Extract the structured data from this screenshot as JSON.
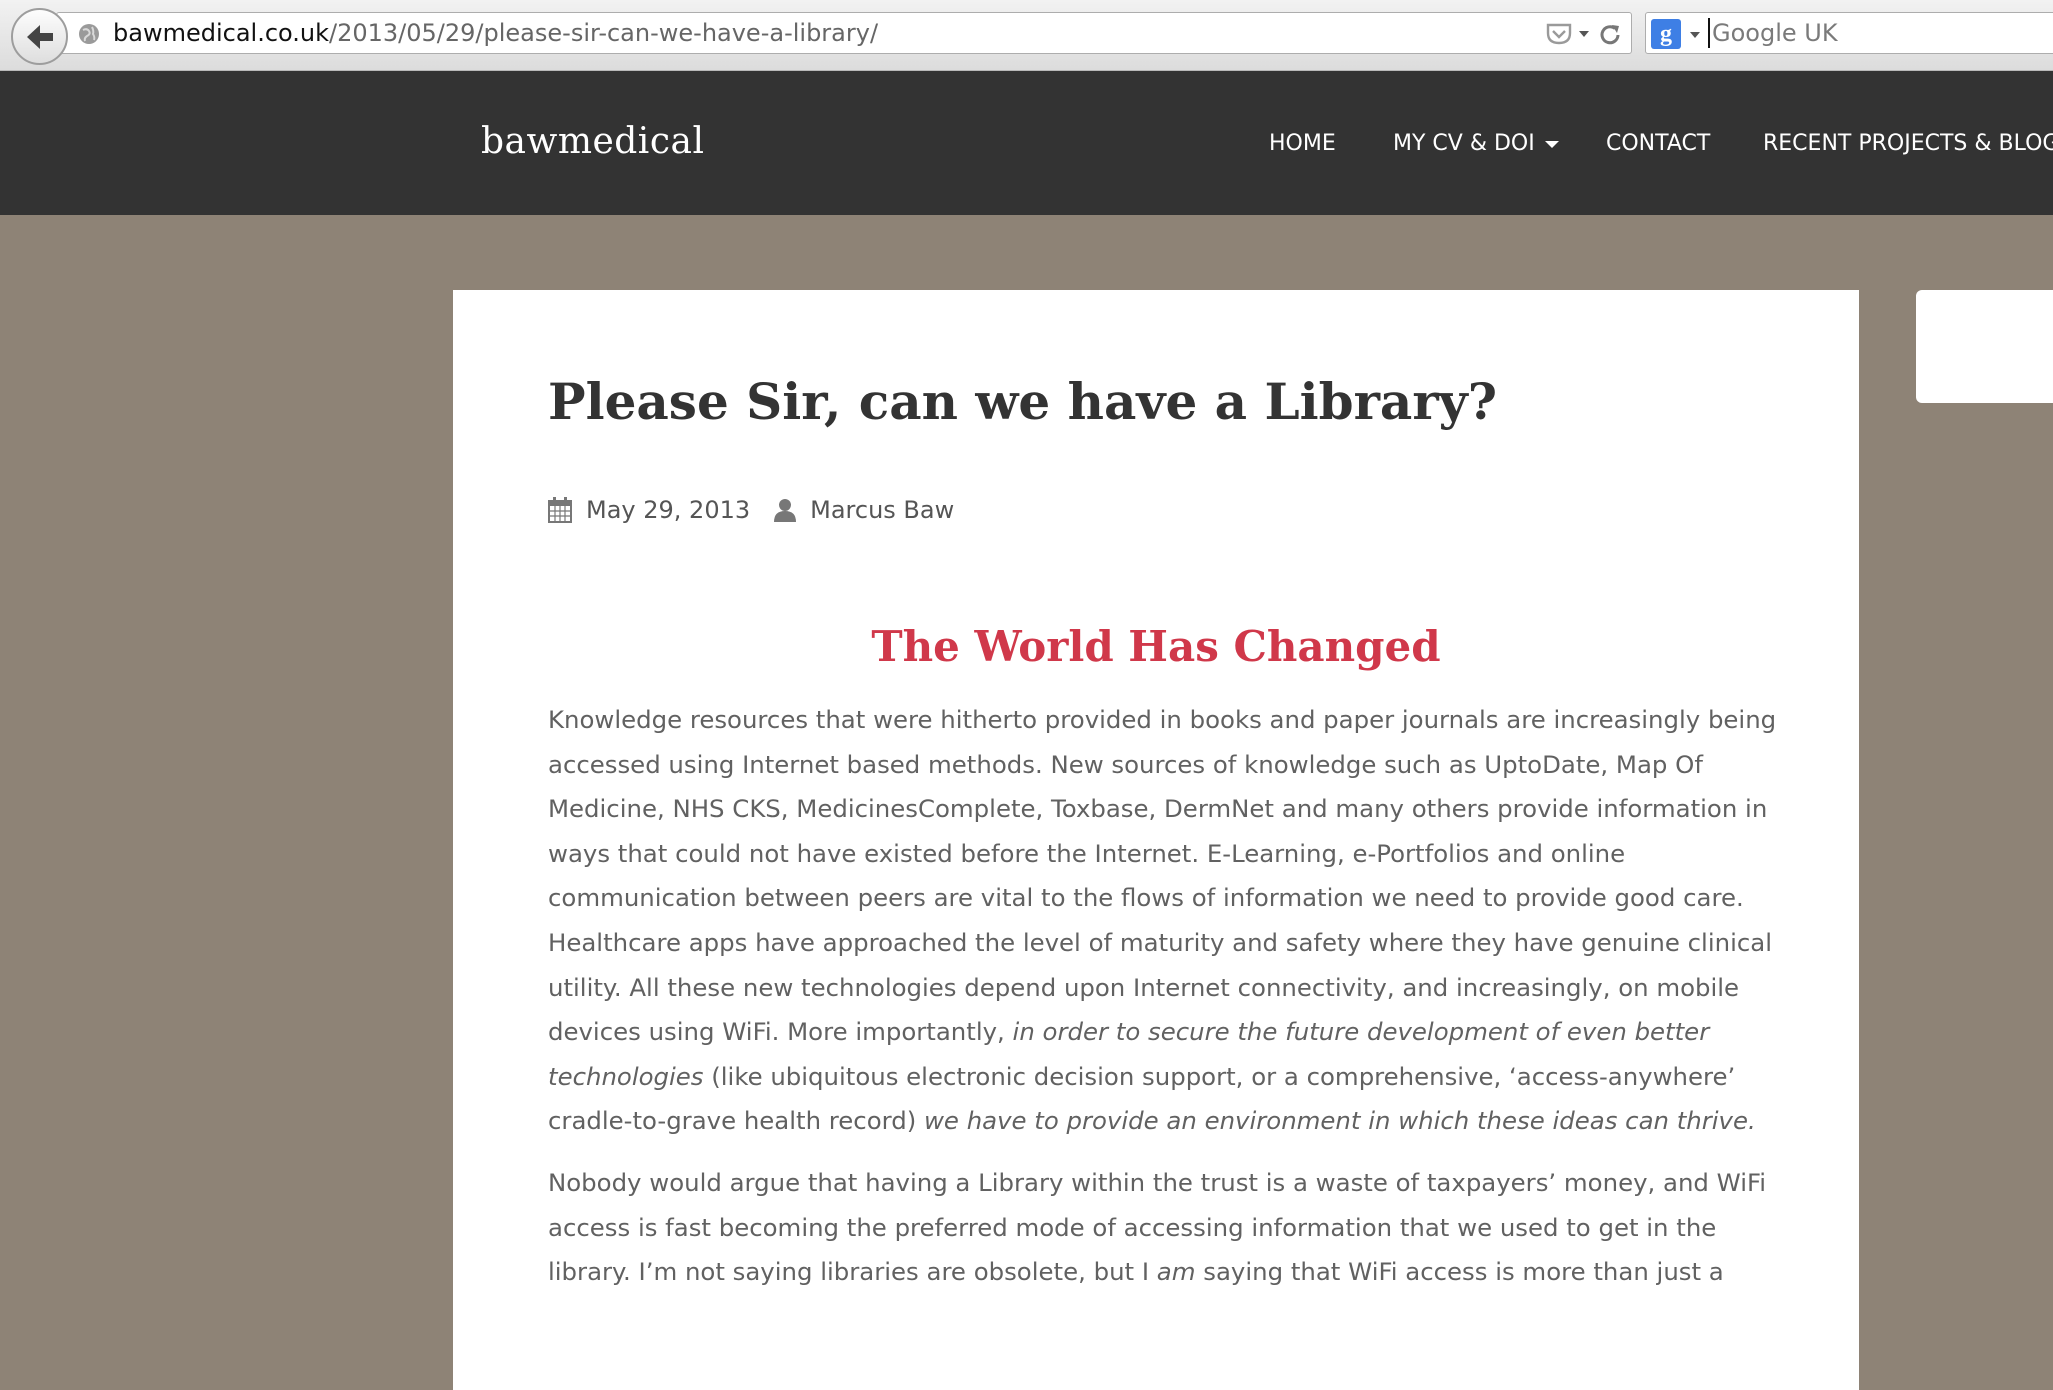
{
  "browser": {
    "url_domain": "bawmedical.co.uk",
    "url_path": "/2013/05/29/please-sir-can-we-have-a-library/",
    "search_engine_icon": "google-g-icon",
    "search_placeholder": "Google UK",
    "icons": [
      "back-arrow-icon",
      "globe-icon",
      "pocket-icon",
      "reload-icon",
      "google-g-icon"
    ]
  },
  "header": {
    "site_title": "bawmedical",
    "nav": [
      {
        "label": "HOME"
      },
      {
        "label": "MY CV & DOI",
        "has_dropdown": true
      },
      {
        "label": "CONTACT"
      },
      {
        "label": "RECENT PROJECTS & BLOG"
      }
    ]
  },
  "post": {
    "title": "Please Sir, can we have a Library?",
    "date": "May 29, 2013",
    "author": "Marcus Baw",
    "section_heading": "The World Has Changed",
    "p1": {
      "a": "Knowledge resources that were hitherto provided in books and paper journals are increasingly being accessed using Internet based methods. New sources of knowledge such as UptoDate, Map Of Medicine, NHS CKS, MedicinesComplete, Toxbase, DermNet and many others provide information in ways that could not have existed before the Internet.  E-Learning, e-Portfolios and online communication between peers are vital to the flows of information we need to provide good care. Healthcare apps have approached the level of maturity and safety where they have genuine clinical utility. All these new technologies depend upon Internet connectivity, and increasingly, on mobile devices using WiFi. More importantly, ",
      "b_italic": "in order to secure the future development of even better technologies",
      "c": " (like ubiquitous electronic decision support, or a comprehensive, ‘access-anywhere’ cradle-to-grave health record) ",
      "d_italic": "we have to provide an environment in which these ideas can thrive."
    },
    "p2": {
      "a": "Nobody would argue that having a Library within the trust is a waste of taxpayers’ money, and WiFi access is fast becoming the preferred mode of accessing information that we used to get in the library. I’m not saying libraries are obsolete, but I ",
      "b_italic": "am",
      "c": " saying that WiFi access is more than just a"
    }
  },
  "colors": {
    "header_bg": "#333333",
    "page_bg": "#8e8376",
    "heading_accent": "#d0384a",
    "body_text": "#616161"
  }
}
